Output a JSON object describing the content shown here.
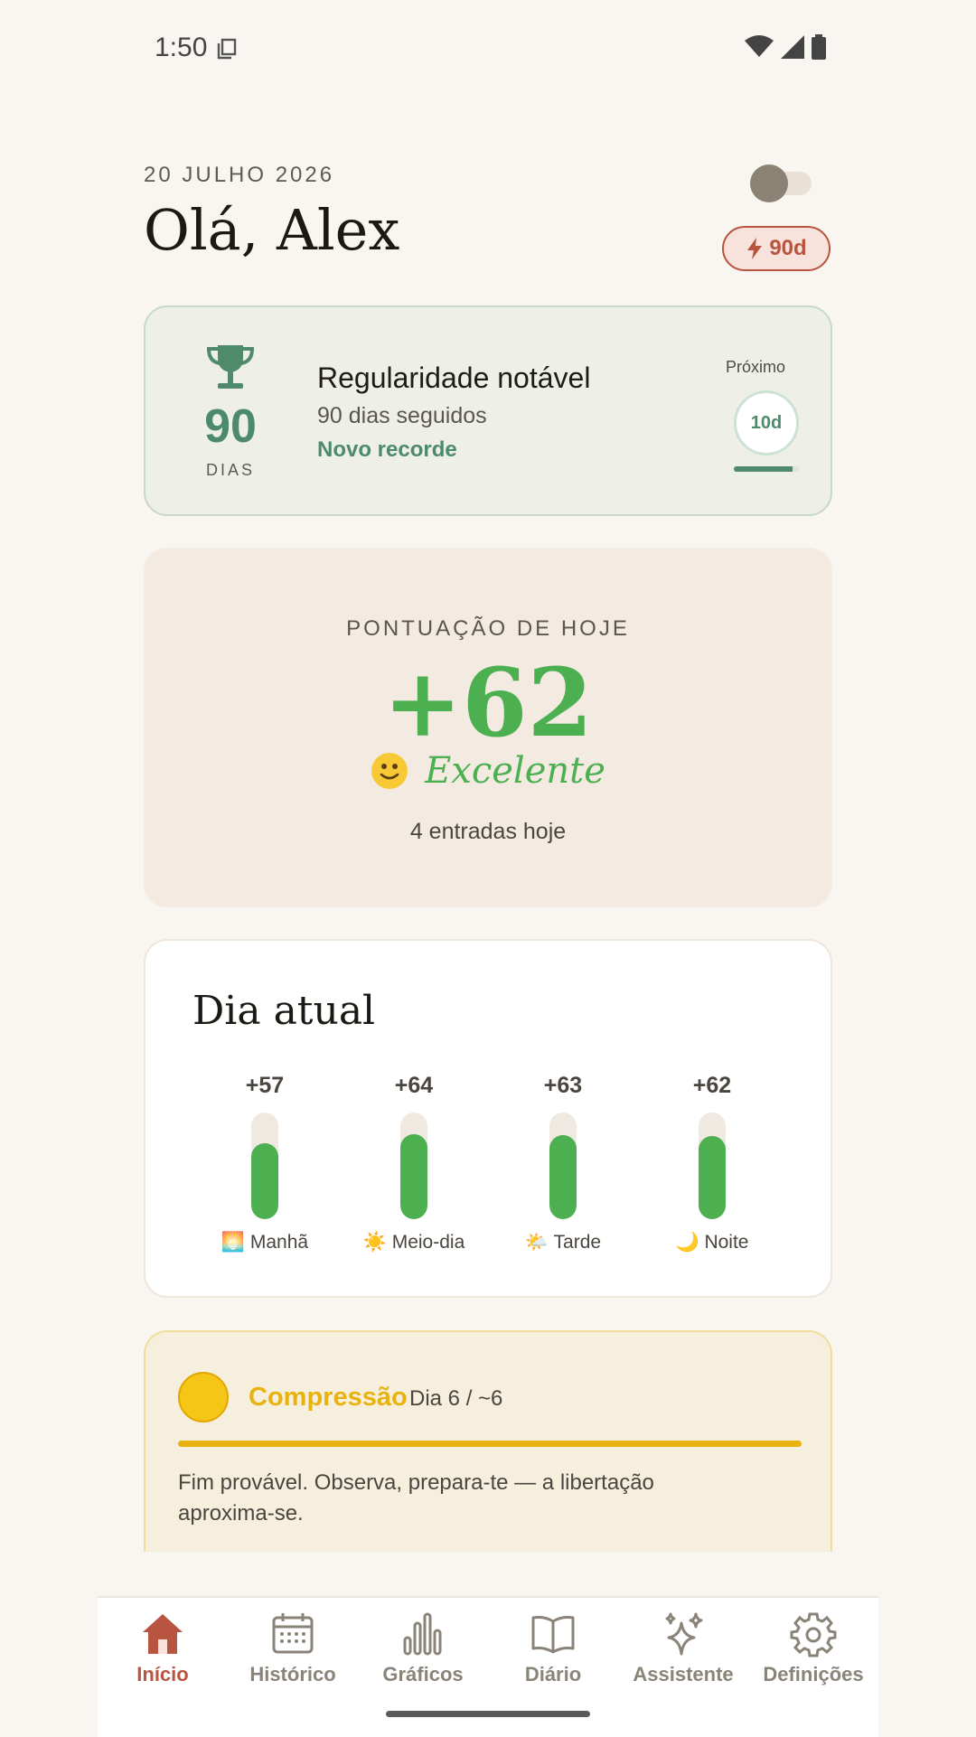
{
  "status_bar": {
    "time": "1:50"
  },
  "header": {
    "date": "20 JULHO 2026",
    "greeting": "Olá, Alex",
    "streak_badge": "90d",
    "toggle_on": false
  },
  "achievement": {
    "count": "90",
    "unit": "DIAS",
    "title": "Regularidade notável",
    "subtitle": "90 dias seguidos",
    "record": "Novo recorde",
    "next_label": "Próximo",
    "next_value": "10d",
    "next_progress": 0.9
  },
  "score": {
    "label": "PONTUAÇÃO DE HOJE",
    "value": "+62",
    "mood": "Excelente",
    "entries": "4 entradas hoje"
  },
  "day": {
    "title": "Dia atual",
    "slots": [
      {
        "value": "+57",
        "label": "🌅 Manhã",
        "level": 0.57
      },
      {
        "value": "+64",
        "label": "☀️ Meio-dia",
        "level": 0.64
      },
      {
        "value": "+63",
        "label": "🌤️ Tarde",
        "level": 0.63
      },
      {
        "value": "+62",
        "label": "🌙 Noite",
        "level": 0.62
      }
    ]
  },
  "phase": {
    "title": "Compressão",
    "day": "Dia 6 / ~6",
    "progress": 1.0,
    "text": "Fim provável. Observa, prepara-te — a libertação aproxima-se."
  },
  "nav": {
    "items": [
      {
        "label": "Início",
        "icon": "home-icon",
        "active": true
      },
      {
        "label": "Histórico",
        "icon": "calendar-icon",
        "active": false
      },
      {
        "label": "Gráficos",
        "icon": "bar-chart-icon",
        "active": false
      },
      {
        "label": "Diário",
        "icon": "book-icon",
        "active": false
      },
      {
        "label": "Assistente",
        "icon": "sparkles-icon",
        "active": false
      },
      {
        "label": "Definições",
        "icon": "gear-icon",
        "active": false
      }
    ]
  },
  "colors": {
    "accent_green": "#4caf50",
    "brand_green": "#4c8a6b",
    "active_nav": "#b8543f",
    "phase_yellow": "#e8b20f"
  }
}
